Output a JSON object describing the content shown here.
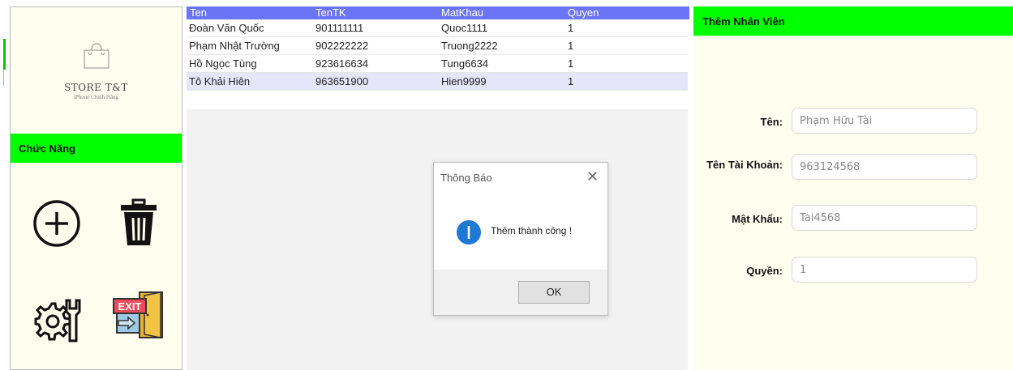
{
  "brand": {
    "name": "STORE T&T",
    "tagline": "iPhone Chính Hãng"
  },
  "sidebar": {
    "title": "Chức Năng",
    "buttons": [
      {
        "icon": "add-circle-icon"
      },
      {
        "icon": "trash-icon"
      },
      {
        "icon": "settings-tools-icon"
      },
      {
        "icon": "exit-door-icon",
        "label": "EXIT"
      }
    ]
  },
  "table": {
    "columns": [
      "Ten",
      "TenTK",
      "MatKhau",
      "Quyen"
    ],
    "rows": [
      [
        "Đoàn Văn Quốc",
        "901111111",
        "Quoc1111",
        "1"
      ],
      [
        "Phạm Nhật Trường",
        "902222222",
        "Truong2222",
        "1"
      ],
      [
        "Hồ Ngọc Tùng",
        "923616634",
        "Tung6634",
        "1"
      ],
      [
        "Tô Khải Hiên",
        "963651900",
        "Hien9999",
        "1"
      ]
    ],
    "selected_row": 3
  },
  "dialog": {
    "title": "Thông Báo",
    "message": "Thêm thành công !",
    "ok_label": "OK"
  },
  "form": {
    "title": "Thêm Nhân Viên",
    "fields": [
      {
        "label": "Tên:",
        "value": "Phạm Hữu Tài"
      },
      {
        "label": "Tên Tài Khoản:",
        "value": "963124568"
      },
      {
        "label": "Mật Khẩu:",
        "value": "Tai4568"
      },
      {
        "label": "Quyền:",
        "value": "1"
      }
    ]
  },
  "colors": {
    "header_green": "#00ff00",
    "panel_bg": "#fffff0",
    "table_header": "#6b74f5",
    "selected_row": "#e6e6fa",
    "info_blue": "#1e78d4"
  }
}
